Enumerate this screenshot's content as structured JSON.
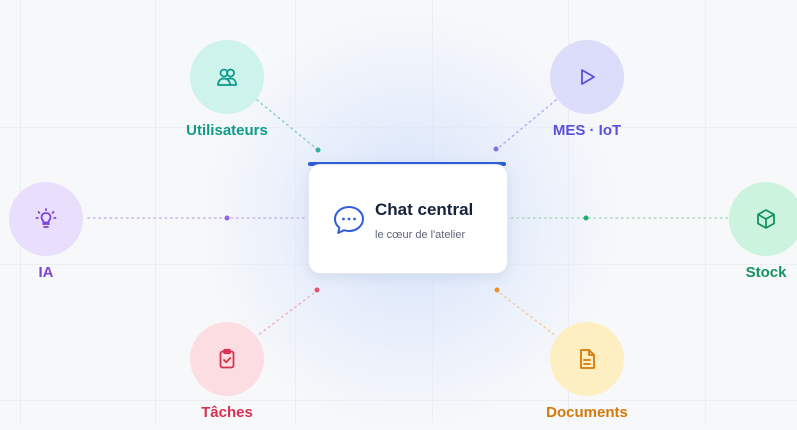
{
  "center": {
    "title": "Chat central",
    "subtitle": "le cœur de l'atelier",
    "accent": "#2f5fd8",
    "icon": "chat-bubble-icon"
  },
  "nodes": [
    {
      "key": "users",
      "label": "Utilisateurs",
      "icon": "users-icon",
      "color": "#0f9a8a",
      "bg": "#cdf3ec"
    },
    {
      "key": "mes",
      "label": "MES · IoT",
      "icon": "play-icon",
      "color": "#5a4fe0",
      "bg": "#dcdcfb"
    },
    {
      "key": "ia",
      "label": "IA",
      "icon": "lightbulb-icon",
      "color": "#7a44d6",
      "bg": "#e9defb"
    },
    {
      "key": "stock",
      "label": "Stock",
      "icon": "package-icon",
      "color": "#12935f",
      "bg": "#ccf3dd"
    },
    {
      "key": "taches",
      "label": "Tâches",
      "icon": "clipboard-check-icon",
      "color": "#d93050",
      "bg": "#fcdde2"
    },
    {
      "key": "documents",
      "label": "Documents",
      "icon": "document-icon",
      "color": "#d7780a",
      "bg": "#fdefc2"
    }
  ]
}
